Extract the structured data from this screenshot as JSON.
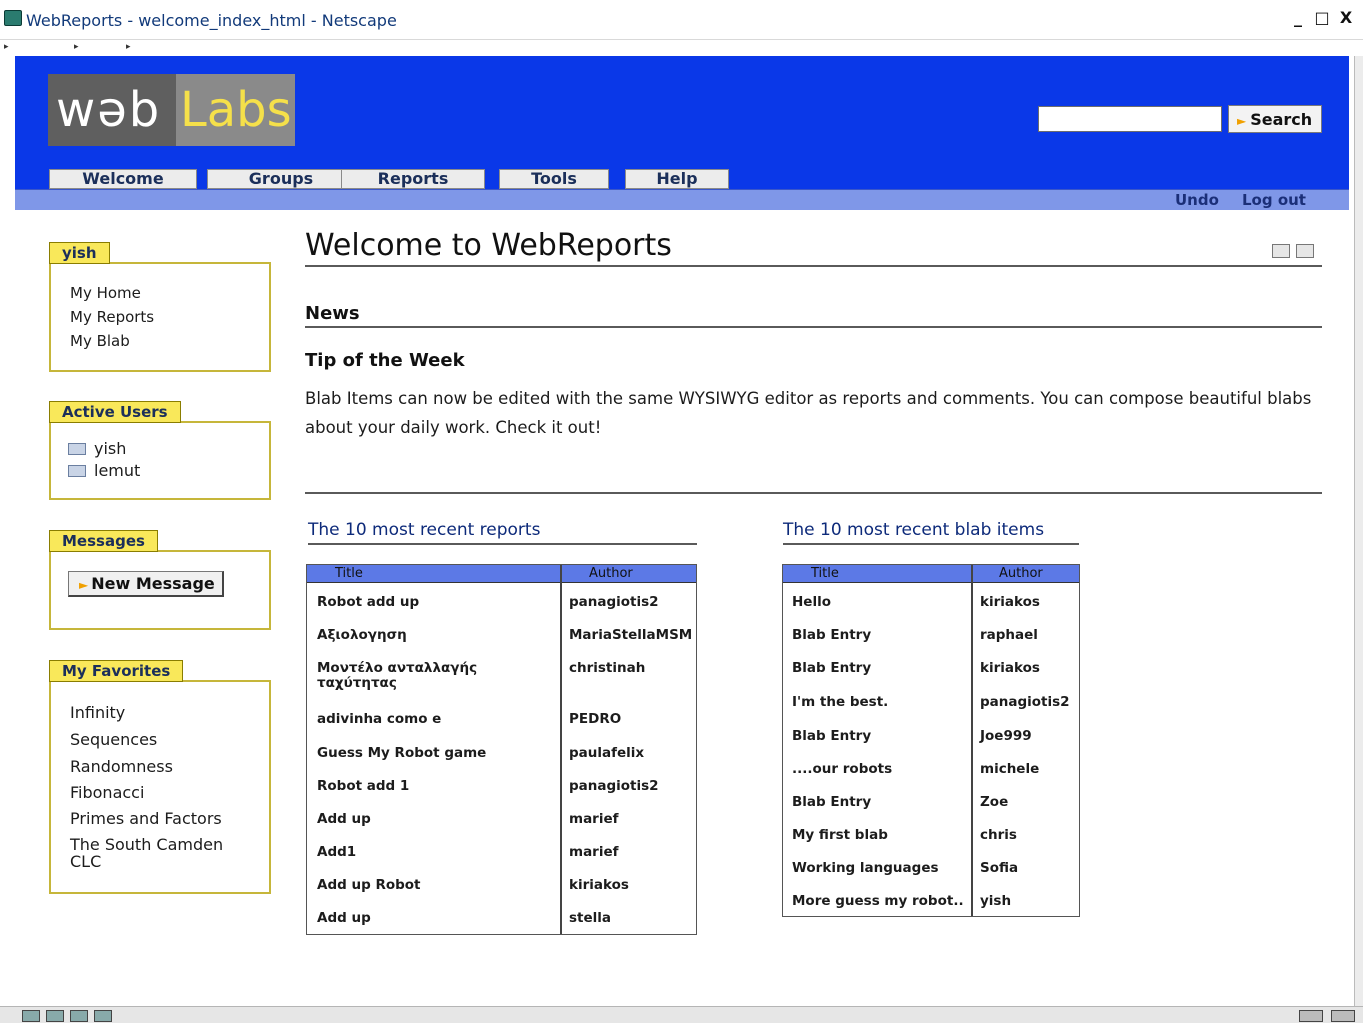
{
  "window": {
    "title": "WebReports - welcome_index_html - Netscape",
    "controls": [
      "_",
      "ᵉ",
      "X"
    ]
  },
  "logo": {
    "part1": "wəb",
    "part2": "Labs"
  },
  "search": {
    "placeholder": "",
    "button_label": "Search"
  },
  "nav": {
    "tabs": [
      "Welcome",
      "Groups",
      "Reports",
      "Tools",
      "Help"
    ],
    "undo": "Undo",
    "logout": "Log out"
  },
  "sidebar": {
    "user_panel": {
      "title": "yish",
      "links": [
        "My Home",
        "My Reports",
        "My Blab"
      ]
    },
    "active_users": {
      "title": "Active Users",
      "users": [
        "yish",
        "lemut"
      ]
    },
    "messages": {
      "title": "Messages",
      "new_message_label": "New Message"
    },
    "favorites": {
      "title": "My Favorites",
      "items": [
        "Infinity",
        "Sequences",
        "Randomness",
        "Fibonacci",
        "Primes and Factors",
        "The South Camden CLC"
      ]
    }
  },
  "main": {
    "title": "Welcome to WebReports",
    "news_heading": "News",
    "tip_heading": "Tip of the Week",
    "tip_body": "Blab Items can now be edited with the same WYSIWYG editor as reports and comments. You can compose beautiful blabs about your daily work. Check it out!",
    "reports": {
      "heading": "The 10 most recent reports",
      "columns": [
        "Title",
        "Author"
      ],
      "rows": [
        [
          "Robot add up",
          "panagiotis2"
        ],
        [
          "Αξιολογηση",
          "MariaStellaMSM"
        ],
        [
          "Μοντέλο ανταλλαγής ταχύτητας",
          "christinah"
        ],
        [
          "adivinha como e",
          "PEDRO"
        ],
        [
          "Guess My Robot game",
          "paulafelix"
        ],
        [
          "Robot add 1",
          "panagiotis2"
        ],
        [
          "Add up",
          "marief"
        ],
        [
          "Add1",
          "marief"
        ],
        [
          "Add up Robot",
          "kiriakos"
        ],
        [
          "Add up",
          "stella"
        ]
      ]
    },
    "blabs": {
      "heading": "The 10 most recent blab items",
      "columns": [
        "Title",
        "Author"
      ],
      "rows": [
        [
          "Hello",
          "kiriakos"
        ],
        [
          "Blab Entry",
          "raphael"
        ],
        [
          "Blab Entry",
          "kiriakos"
        ],
        [
          "I'm the best.",
          "panagiotis2"
        ],
        [
          "Blab Entry",
          "Joe999"
        ],
        [
          "....our robots",
          "michele"
        ],
        [
          "Blab Entry",
          "Zoe"
        ],
        [
          "My first blab",
          "chris"
        ],
        [
          "Working languages",
          "Sofia"
        ],
        [
          "More guess my robot..",
          "yish"
        ]
      ]
    }
  },
  "colors": {
    "header": "#0a38e8",
    "subbar": "#7f97e8",
    "panel_tab": "#f9e85a",
    "table_header": "#5c79e6"
  }
}
